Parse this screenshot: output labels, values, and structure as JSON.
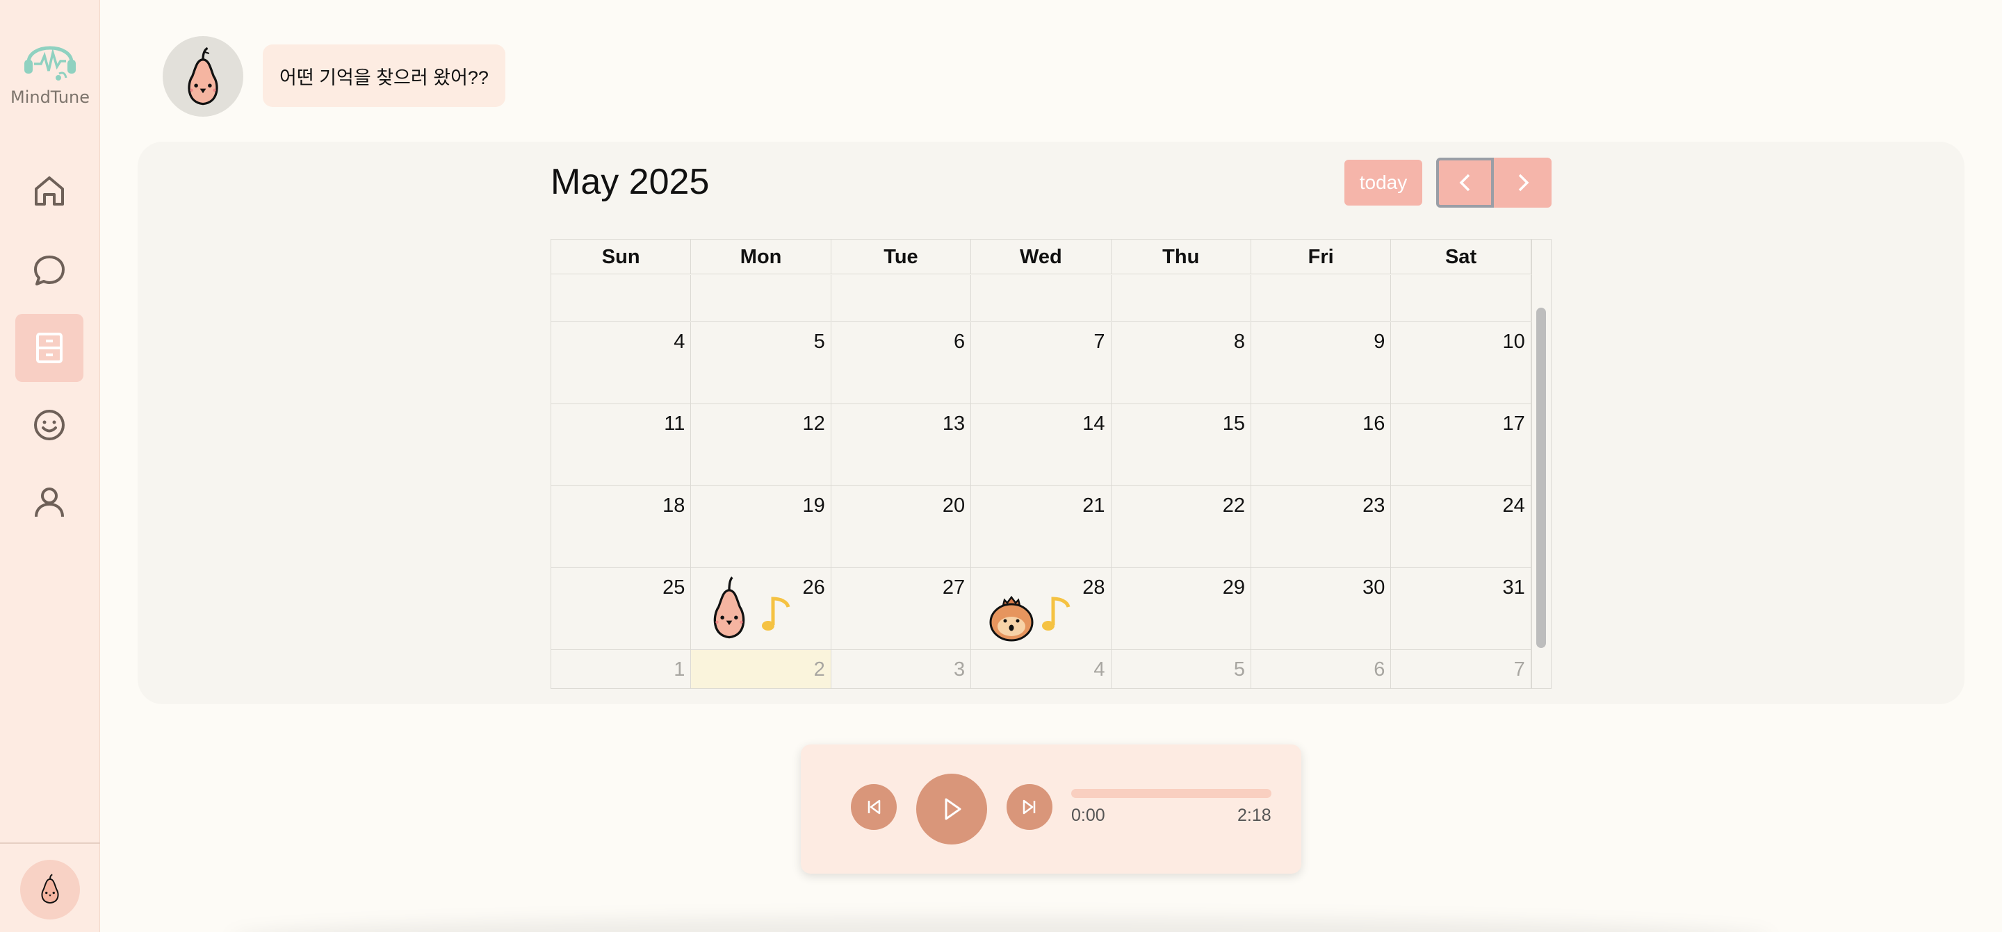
{
  "app": {
    "name": "MindTune"
  },
  "sidebar": {
    "items": [
      {
        "name": "home",
        "icon": "home-icon",
        "active": false
      },
      {
        "name": "chat",
        "icon": "chat-bubble-icon",
        "active": false
      },
      {
        "name": "archive",
        "icon": "drawer-icon",
        "active": true
      },
      {
        "name": "emotion",
        "icon": "smile-icon",
        "active": false
      },
      {
        "name": "profile",
        "icon": "user-icon",
        "active": false
      }
    ]
  },
  "chat": {
    "message": "어떤 기억을 찾으러 왔어??"
  },
  "calendar": {
    "title": "May 2025",
    "today_label": "today",
    "weekdays": [
      "Sun",
      "Mon",
      "Tue",
      "Wed",
      "Thu",
      "Fri",
      "Sat"
    ],
    "weeks": [
      [
        "",
        "",
        "",
        "",
        "",
        "",
        ""
      ],
      [
        "4",
        "5",
        "6",
        "7",
        "8",
        "9",
        "10"
      ],
      [
        "11",
        "12",
        "13",
        "14",
        "15",
        "16",
        "17"
      ],
      [
        "18",
        "19",
        "20",
        "21",
        "22",
        "23",
        "24"
      ],
      [
        "25",
        "26",
        "27",
        "28",
        "29",
        "30",
        "31"
      ],
      [
        "1",
        "2",
        "3",
        "4",
        "5",
        "6",
        "7"
      ]
    ],
    "events": [
      {
        "date": "2025-05-26",
        "character": "pear-character-icon",
        "mark": "music-note-icon"
      },
      {
        "date": "2025-05-28",
        "character": "onion-character-icon",
        "mark": "music-note-icon"
      }
    ]
  },
  "player": {
    "current_time": "0:00",
    "total_time": "2:18",
    "progress": 0
  },
  "colors": {
    "accent": "#f5b5aa",
    "sidebar_bg": "#fdebe2",
    "player_button": "#d9967a",
    "note": "#f5c242"
  }
}
